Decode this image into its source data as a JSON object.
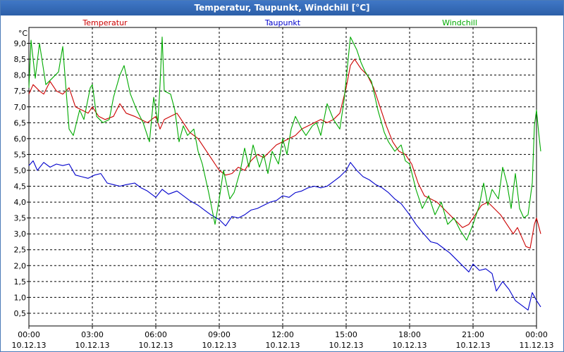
{
  "title": "Temperatur, Taupunkt, Windchill [°C]",
  "colors": {
    "Temperatur": "#cc0000",
    "Taupunkt": "#0000cc",
    "Windchill": "#00aa00",
    "grid": "#000000",
    "title_bg": "#3068b8"
  },
  "chart_data": {
    "type": "line",
    "title": "Temperatur, Taupunkt, Windchill [°C]",
    "ylabel": "°C",
    "ylim": [
      0.1,
      9.5
    ],
    "grid": true,
    "legend_placement": "top",
    "y_ticks": [
      "0,5",
      "1,0",
      "1,5",
      "2,0",
      "2,5",
      "3,0",
      "3,5",
      "4,0",
      "4,5",
      "5,0",
      "5,5",
      "6,0",
      "6,5",
      "7,0",
      "7,5",
      "8,0",
      "8,5",
      "9,0"
    ],
    "y_tick_values": [
      0.5,
      1,
      1.5,
      2,
      2.5,
      3,
      3.5,
      4,
      4.5,
      5,
      5.5,
      6,
      6.5,
      7,
      7.5,
      8,
      8.5,
      9
    ],
    "x_ticks": [
      {
        "time": "00:00",
        "date": "10.12.13",
        "hour": 0
      },
      {
        "time": "03:00",
        "date": "10.12.13",
        "hour": 3
      },
      {
        "time": "06:00",
        "date": "10.12.13",
        "hour": 6
      },
      {
        "time": "09:00",
        "date": "10.12.13",
        "hour": 9
      },
      {
        "time": "12:00",
        "date": "10.12.13",
        "hour": 12
      },
      {
        "time": "15:00",
        "date": "10.12.13",
        "hour": 15
      },
      {
        "time": "18:00",
        "date": "10.12.13",
        "hour": 18
      },
      {
        "time": "21:00",
        "date": "10.12.13",
        "hour": 21
      },
      {
        "time": "00:00",
        "date": "11.12.13",
        "hour": 24
      }
    ],
    "x_unit": "hours since 10.12.13 00:00",
    "series": [
      {
        "name": "Temperatur",
        "color": "#cc0000",
        "points": [
          [
            0,
            7.4
          ],
          [
            0.2,
            7.7
          ],
          [
            0.5,
            7.5
          ],
          [
            0.7,
            7.4
          ],
          [
            1,
            7.8
          ],
          [
            1.3,
            7.5
          ],
          [
            1.6,
            7.4
          ],
          [
            1.9,
            7.6
          ],
          [
            2.2,
            7.0
          ],
          [
            2.5,
            6.9
          ],
          [
            2.8,
            6.8
          ],
          [
            3,
            7.0
          ],
          [
            3.3,
            6.7
          ],
          [
            3.6,
            6.6
          ],
          [
            4,
            6.7
          ],
          [
            4.3,
            7.1
          ],
          [
            4.6,
            6.8
          ],
          [
            5,
            6.7
          ],
          [
            5.3,
            6.6
          ],
          [
            5.6,
            6.5
          ],
          [
            6,
            6.7
          ],
          [
            6.2,
            6.3
          ],
          [
            6.4,
            6.6
          ],
          [
            6.7,
            6.7
          ],
          [
            7,
            6.8
          ],
          [
            7.3,
            6.5
          ],
          [
            7.6,
            6.2
          ],
          [
            8,
            6.0
          ],
          [
            8.3,
            5.7
          ],
          [
            8.6,
            5.4
          ],
          [
            9,
            5.0
          ],
          [
            9.3,
            4.85
          ],
          [
            9.6,
            4.9
          ],
          [
            9.9,
            5.1
          ],
          [
            10.2,
            5.0
          ],
          [
            10.5,
            5.3
          ],
          [
            10.8,
            5.5
          ],
          [
            11.1,
            5.4
          ],
          [
            11.4,
            5.6
          ],
          [
            11.7,
            5.8
          ],
          [
            12,
            5.9
          ],
          [
            12.3,
            6.0
          ],
          [
            12.6,
            6.1
          ],
          [
            12.9,
            6.3
          ],
          [
            13.2,
            6.4
          ],
          [
            13.5,
            6.5
          ],
          [
            13.8,
            6.6
          ],
          [
            14.1,
            6.5
          ],
          [
            14.4,
            6.6
          ],
          [
            14.7,
            6.8
          ],
          [
            15,
            7.6
          ],
          [
            15.2,
            8.3
          ],
          [
            15.4,
            8.5
          ],
          [
            15.7,
            8.2
          ],
          [
            16,
            8.0
          ],
          [
            16.3,
            7.6
          ],
          [
            16.6,
            7.0
          ],
          [
            16.9,
            6.4
          ],
          [
            17.2,
            5.9
          ],
          [
            17.5,
            5.6
          ],
          [
            17.8,
            5.5
          ],
          [
            18.1,
            5.2
          ],
          [
            18.4,
            4.6
          ],
          [
            18.7,
            4.2
          ],
          [
            19,
            4.1
          ],
          [
            19.3,
            4.0
          ],
          [
            19.6,
            3.8
          ],
          [
            19.9,
            3.6
          ],
          [
            20.2,
            3.4
          ],
          [
            20.5,
            3.2
          ],
          [
            20.8,
            3.3
          ],
          [
            21.1,
            3.6
          ],
          [
            21.4,
            3.9
          ],
          [
            21.7,
            4.0
          ],
          [
            22,
            3.8
          ],
          [
            22.3,
            3.6
          ],
          [
            22.6,
            3.3
          ],
          [
            22.9,
            3.0
          ],
          [
            23.1,
            3.2
          ],
          [
            23.3,
            2.9
          ],
          [
            23.5,
            2.6
          ],
          [
            23.7,
            2.55
          ],
          [
            23.9,
            3.3
          ],
          [
            24,
            3.5
          ],
          [
            24.2,
            3.0
          ]
        ]
      },
      {
        "name": "Taupunkt",
        "color": "#0000cc",
        "points": [
          [
            0,
            5.15
          ],
          [
            0.2,
            5.3
          ],
          [
            0.4,
            5.0
          ],
          [
            0.7,
            5.25
          ],
          [
            1,
            5.1
          ],
          [
            1.3,
            5.2
          ],
          [
            1.6,
            5.15
          ],
          [
            1.9,
            5.2
          ],
          [
            2.2,
            4.85
          ],
          [
            2.5,
            4.8
          ],
          [
            2.8,
            4.75
          ],
          [
            3.1,
            4.85
          ],
          [
            3.4,
            4.9
          ],
          [
            3.7,
            4.6
          ],
          [
            4,
            4.55
          ],
          [
            4.3,
            4.5
          ],
          [
            4.6,
            4.55
          ],
          [
            5,
            4.6
          ],
          [
            5.3,
            4.45
          ],
          [
            5.6,
            4.35
          ],
          [
            6,
            4.15
          ],
          [
            6.3,
            4.4
          ],
          [
            6.6,
            4.25
          ],
          [
            7,
            4.35
          ],
          [
            7.3,
            4.2
          ],
          [
            7.6,
            4.05
          ],
          [
            8,
            3.9
          ],
          [
            8.3,
            3.75
          ],
          [
            8.6,
            3.6
          ],
          [
            9,
            3.45
          ],
          [
            9.3,
            3.25
          ],
          [
            9.6,
            3.55
          ],
          [
            9.9,
            3.5
          ],
          [
            10.2,
            3.6
          ],
          [
            10.5,
            3.75
          ],
          [
            10.8,
            3.8
          ],
          [
            11.1,
            3.9
          ],
          [
            11.4,
            4.0
          ],
          [
            11.7,
            4.05
          ],
          [
            12,
            4.2
          ],
          [
            12.3,
            4.15
          ],
          [
            12.6,
            4.3
          ],
          [
            12.9,
            4.35
          ],
          [
            13.2,
            4.45
          ],
          [
            13.5,
            4.5
          ],
          [
            13.8,
            4.45
          ],
          [
            14.1,
            4.5
          ],
          [
            14.4,
            4.65
          ],
          [
            14.7,
            4.8
          ],
          [
            15,
            5.0
          ],
          [
            15.2,
            5.25
          ],
          [
            15.5,
            5.0
          ],
          [
            15.8,
            4.8
          ],
          [
            16.1,
            4.7
          ],
          [
            16.4,
            4.55
          ],
          [
            16.7,
            4.45
          ],
          [
            17,
            4.3
          ],
          [
            17.3,
            4.1
          ],
          [
            17.6,
            3.95
          ],
          [
            18,
            3.6
          ],
          [
            18.3,
            3.3
          ],
          [
            18.6,
            3.05
          ],
          [
            19,
            2.75
          ],
          [
            19.3,
            2.7
          ],
          [
            19.6,
            2.55
          ],
          [
            19.9,
            2.4
          ],
          [
            20.2,
            2.2
          ],
          [
            20.5,
            2.0
          ],
          [
            20.8,
            1.8
          ],
          [
            21,
            2.05
          ],
          [
            21.3,
            1.85
          ],
          [
            21.6,
            1.9
          ],
          [
            21.9,
            1.75
          ],
          [
            22.1,
            1.2
          ],
          [
            22.4,
            1.5
          ],
          [
            22.7,
            1.25
          ],
          [
            23,
            0.9
          ],
          [
            23.3,
            0.75
          ],
          [
            23.6,
            0.6
          ],
          [
            23.8,
            1.15
          ],
          [
            24,
            0.9
          ],
          [
            24.2,
            0.7
          ]
        ]
      },
      {
        "name": "Windchill",
        "color": "#00aa00",
        "points": [
          [
            0,
            7.6
          ],
          [
            0.1,
            9.1
          ],
          [
            0.3,
            7.9
          ],
          [
            0.5,
            9.0
          ],
          [
            0.8,
            7.7
          ],
          [
            1.1,
            7.9
          ],
          [
            1.4,
            8.1
          ],
          [
            1.6,
            8.9
          ],
          [
            1.9,
            6.3
          ],
          [
            2.1,
            6.1
          ],
          [
            2.4,
            6.9
          ],
          [
            2.6,
            6.6
          ],
          [
            2.9,
            7.6
          ],
          [
            3,
            7.7
          ],
          [
            3.2,
            6.7
          ],
          [
            3.5,
            6.5
          ],
          [
            3.8,
            6.6
          ],
          [
            4,
            7.3
          ],
          [
            4.3,
            8.0
          ],
          [
            4.5,
            8.3
          ],
          [
            4.8,
            7.4
          ],
          [
            5.1,
            6.9
          ],
          [
            5.4,
            6.5
          ],
          [
            5.7,
            5.9
          ],
          [
            5.9,
            7.3
          ],
          [
            6.1,
            6.5
          ],
          [
            6.2,
            7.7
          ],
          [
            6.3,
            9.2
          ],
          [
            6.4,
            7.5
          ],
          [
            6.7,
            7.4
          ],
          [
            6.9,
            6.9
          ],
          [
            7.1,
            5.9
          ],
          [
            7.3,
            6.4
          ],
          [
            7.5,
            6.1
          ],
          [
            7.8,
            6.3
          ],
          [
            8,
            5.6
          ],
          [
            8.2,
            5.2
          ],
          [
            8.5,
            4.3
          ],
          [
            8.8,
            3.3
          ],
          [
            9,
            4.1
          ],
          [
            9.2,
            5.0
          ],
          [
            9.5,
            4.1
          ],
          [
            9.7,
            4.3
          ],
          [
            10,
            5.0
          ],
          [
            10.2,
            5.7
          ],
          [
            10.4,
            5.1
          ],
          [
            10.6,
            5.8
          ],
          [
            10.9,
            5.1
          ],
          [
            11.1,
            5.5
          ],
          [
            11.3,
            4.9
          ],
          [
            11.5,
            5.6
          ],
          [
            11.8,
            5.2
          ],
          [
            12,
            6.0
          ],
          [
            12.2,
            5.5
          ],
          [
            12.4,
            6.3
          ],
          [
            12.6,
            6.7
          ],
          [
            12.9,
            6.3
          ],
          [
            13.1,
            6.1
          ],
          [
            13.4,
            6.4
          ],
          [
            13.6,
            6.5
          ],
          [
            13.8,
            6.1
          ],
          [
            14.1,
            7.1
          ],
          [
            14.4,
            6.6
          ],
          [
            14.7,
            6.3
          ],
          [
            14.9,
            7.2
          ],
          [
            15.2,
            9.2
          ],
          [
            15.5,
            8.8
          ],
          [
            15.7,
            8.4
          ],
          [
            15.9,
            8.1
          ],
          [
            16.2,
            7.8
          ],
          [
            16.5,
            6.9
          ],
          [
            16.8,
            6.2
          ],
          [
            17,
            5.9
          ],
          [
            17.3,
            5.6
          ],
          [
            17.6,
            5.8
          ],
          [
            17.8,
            5.3
          ],
          [
            18,
            5.2
          ],
          [
            18.3,
            4.4
          ],
          [
            18.6,
            3.8
          ],
          [
            18.9,
            4.2
          ],
          [
            19.2,
            3.6
          ],
          [
            19.5,
            4.0
          ],
          [
            19.8,
            3.3
          ],
          [
            20.1,
            3.5
          ],
          [
            20.4,
            3.1
          ],
          [
            20.7,
            2.8
          ],
          [
            21,
            3.3
          ],
          [
            21.3,
            3.9
          ],
          [
            21.5,
            4.6
          ],
          [
            21.7,
            3.9
          ],
          [
            21.9,
            4.4
          ],
          [
            22.2,
            4.1
          ],
          [
            22.4,
            5.1
          ],
          [
            22.6,
            4.6
          ],
          [
            22.8,
            3.8
          ],
          [
            23,
            4.9
          ],
          [
            23.2,
            3.8
          ],
          [
            23.4,
            3.5
          ],
          [
            23.6,
            3.6
          ],
          [
            23.8,
            4.6
          ],
          [
            23.9,
            6.4
          ],
          [
            24,
            6.9
          ],
          [
            24.1,
            6.2
          ],
          [
            24.2,
            5.6
          ]
        ]
      }
    ]
  }
}
